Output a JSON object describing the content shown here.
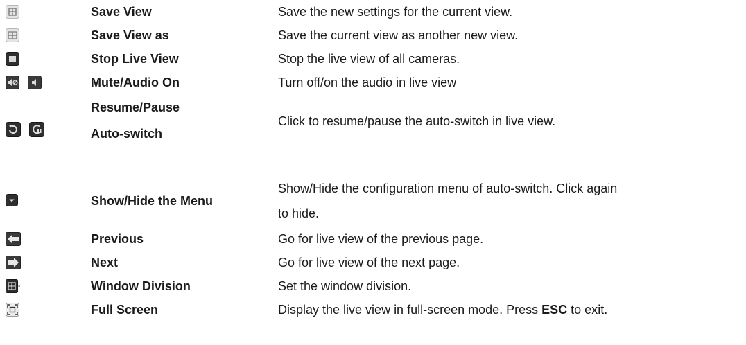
{
  "colors": {
    "icon_light_bg": "#e6e6e6",
    "icon_dark_bg": "#3a3a3a",
    "text": "#1a1a1a"
  },
  "rows": [
    {
      "icons": [
        "save-view-icon"
      ],
      "name": "Save View",
      "desc": "Save the new settings for the current view."
    },
    {
      "icons": [
        "save-view-as-icon"
      ],
      "name": "Save View as",
      "desc": "Save the current view as another new view."
    },
    {
      "icons": [
        "stop-live-view-icon"
      ],
      "name": "Stop Live View",
      "desc": "Stop the live view of all cameras."
    },
    {
      "icons": [
        "mute-icon",
        "audio-on-icon"
      ],
      "name": "Mute/Audio On",
      "desc": "Turn off/on the audio in live view"
    },
    {
      "icons": [
        "resume-icon",
        "pause-icon"
      ],
      "name_line1": "Resume/Pause",
      "name_line2": "Auto-switch",
      "desc": "Click to resume/pause the auto-switch in live view."
    },
    {
      "icons": [
        "show-hide-menu-icon"
      ],
      "name": "Show/Hide the Menu",
      "desc_line1": "Show/Hide the configuration menu of auto-switch. Click again",
      "desc_line2": "to hide."
    },
    {
      "icons": [
        "previous-arrow-icon"
      ],
      "name": "Previous",
      "desc": "Go for live view of the previous page."
    },
    {
      "icons": [
        "next-arrow-icon"
      ],
      "name": "Next",
      "desc": "Go for live view of the next page."
    },
    {
      "icons": [
        "window-division-icon"
      ],
      "name": "Window Division",
      "desc": "Set the window division."
    },
    {
      "icons": [
        "full-screen-icon"
      ],
      "name": "Full Screen",
      "desc_before": "Display the live view in full-screen mode. Press ",
      "desc_key": "ESC",
      "desc_after": " to exit."
    }
  ]
}
